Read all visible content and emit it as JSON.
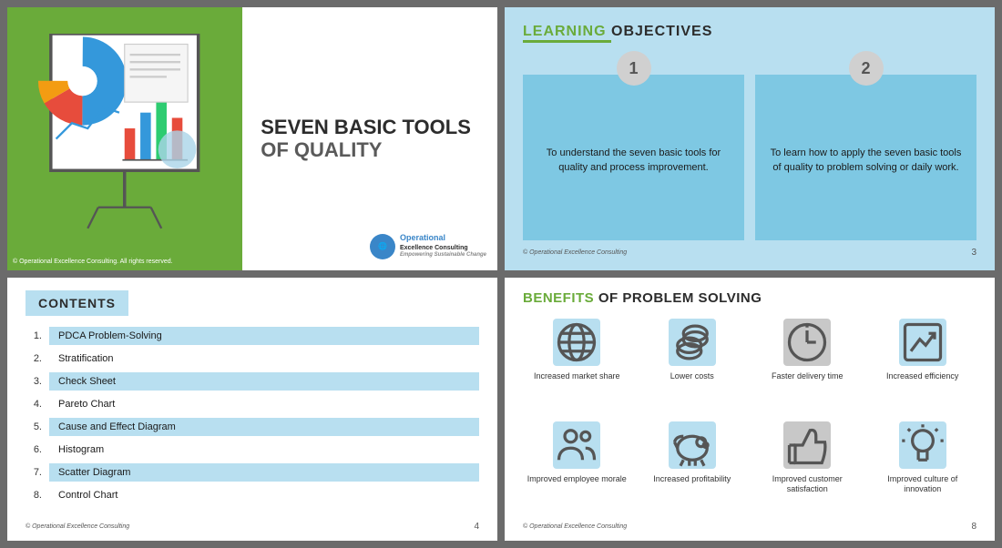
{
  "slide1": {
    "title_line1": "SEVEN BASIC TOOLS",
    "title_line2": "OF QUALITY",
    "copyright": "© Operational Excellence Consulting. All rights reserved.",
    "logo_brand": "Operational",
    "logo_line2": "Excellence Consulting",
    "logo_tagline": "Empowering Sustainable Change"
  },
  "slide2": {
    "header_highlight": "LEARNING ",
    "header_rest": "OBJECTIVES",
    "card1_number": "1",
    "card1_text": "To understand the seven basic tools for quality and process improvement.",
    "card2_number": "2",
    "card2_text": "To learn how to apply the seven basic tools of quality to problem solving or daily work.",
    "footer_copy": "© Operational Excellence Consulting",
    "page_num": "3"
  },
  "slide3": {
    "header": "CONTENTS",
    "items": [
      {
        "num": "1.",
        "label": "PDCA Problem-Solving",
        "highlighted": true
      },
      {
        "num": "2.",
        "label": "Stratification",
        "highlighted": false
      },
      {
        "num": "3.",
        "label": "Check Sheet",
        "highlighted": true
      },
      {
        "num": "4.",
        "label": "Pareto Chart",
        "highlighted": false
      },
      {
        "num": "5.",
        "label": "Cause and Effect Diagram",
        "highlighted": true
      },
      {
        "num": "6.",
        "label": "Histogram",
        "highlighted": false
      },
      {
        "num": "7.",
        "label": "Scatter Diagram",
        "highlighted": true
      },
      {
        "num": "8.",
        "label": "Control Chart",
        "highlighted": false
      }
    ],
    "footer_copy": "© Operational Excellence Consulting",
    "page_num": "4"
  },
  "slide4": {
    "header_highlight": "BENEFITS ",
    "header_rest": "OF PROBLEM SOLVING",
    "benefits": [
      {
        "label": "Increased market share",
        "icon": "globe",
        "box_color": "blue"
      },
      {
        "label": "Lower costs",
        "icon": "coins",
        "box_color": "blue"
      },
      {
        "label": "Faster delivery time",
        "icon": "clock",
        "box_color": "gray"
      },
      {
        "label": "Increased efficiency",
        "icon": "chart-up",
        "box_color": "blue"
      },
      {
        "label": "Improved employee morale",
        "icon": "people",
        "box_color": "blue"
      },
      {
        "label": "Increased profitability",
        "icon": "piggy",
        "box_color": "blue"
      },
      {
        "label": "Improved customer satisfaction",
        "icon": "thumb",
        "box_color": "gray"
      },
      {
        "label": "Improved culture of innovation",
        "icon": "bulb",
        "box_color": "blue"
      }
    ],
    "footer_copy": "© Operational Excellence Consulting",
    "page_num": "8"
  }
}
